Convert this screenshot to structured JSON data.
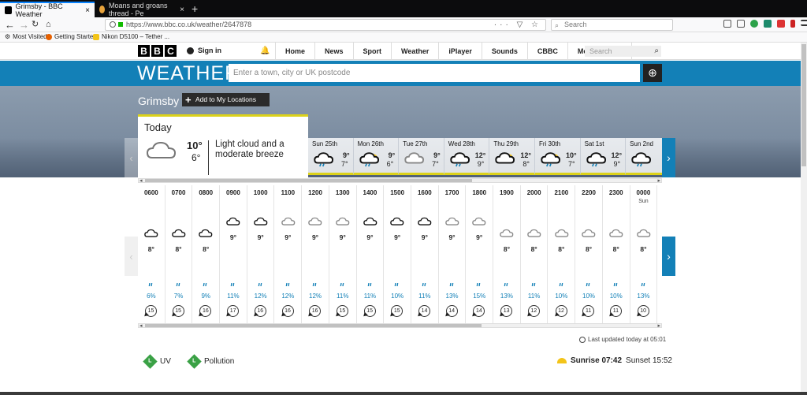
{
  "browser": {
    "tabs": [
      {
        "title": "Grimsby - BBC Weather",
        "close": "×"
      },
      {
        "title": "Moans and groans thread - Pe",
        "close": "×"
      }
    ],
    "new_tab": "+",
    "url": "https://www.bbc.co.uk/weather/2647878",
    "url_icons": "··· ▽ ☆",
    "search_placeholder": "Search",
    "bookmarks": [
      "Most Visited",
      "Getting Started",
      "Nikon D5100 – Tether ..."
    ]
  },
  "bbc": {
    "logo": [
      "B",
      "B",
      "C"
    ],
    "signin": "Sign in",
    "nav": [
      "Home",
      "News",
      "Sport",
      "Weather",
      "iPlayer",
      "Sounds",
      "CBBC",
      "More"
    ],
    "more_caret": "▾",
    "search_placeholder": "Search"
  },
  "weather": {
    "title": "WEATHER",
    "search_placeholder": "Enter a town, city or UK postcode",
    "location": "Grimsby",
    "add_location": "Add to My Locations",
    "today": {
      "label": "Today",
      "high": "10°",
      "low": "6°",
      "description": "Light cloud and a moderate breeze"
    },
    "days": [
      {
        "name": "Sun 25th",
        "high": "9°",
        "low": "7°",
        "icon": "light-rain"
      },
      {
        "name": "Mon 26th",
        "high": "9°",
        "low": "6°",
        "icon": "sunny-intervals-rain"
      },
      {
        "name": "Tue 27th",
        "high": "9°",
        "low": "7°",
        "icon": "light-cloud"
      },
      {
        "name": "Wed 28th",
        "high": "12°",
        "low": "9°",
        "icon": "light-rain"
      },
      {
        "name": "Thu 29th",
        "high": "12°",
        "low": "8°",
        "icon": "sunny-intervals"
      },
      {
        "name": "Fri 30th",
        "high": "10°",
        "low": "7°",
        "icon": "sunny-intervals-rain"
      },
      {
        "name": "Sat 1st",
        "high": "12°",
        "low": "9°",
        "icon": "light-rain"
      },
      {
        "name": "Sun 2nd",
        "high": "1",
        "low": "",
        "icon": "light-rain"
      }
    ],
    "hours": [
      {
        "time": "0600",
        "sub": "",
        "temp": "8°",
        "rain": "6%",
        "wind": "15",
        "icon": "cloud-dark",
        "level": 2
      },
      {
        "time": "0700",
        "sub": "",
        "temp": "8°",
        "rain": "7%",
        "wind": "15",
        "icon": "cloud-dark",
        "level": 2
      },
      {
        "time": "0800",
        "sub": "",
        "temp": "8°",
        "rain": "9%",
        "wind": "16",
        "icon": "cloud-dark",
        "level": 2
      },
      {
        "time": "0900",
        "sub": "",
        "temp": "9°",
        "rain": "11%",
        "wind": "17",
        "icon": "cloud-dark",
        "level": 1
      },
      {
        "time": "1000",
        "sub": "",
        "temp": "9°",
        "rain": "12%",
        "wind": "16",
        "icon": "cloud-dark",
        "level": 1
      },
      {
        "time": "1100",
        "sub": "",
        "temp": "9°",
        "rain": "12%",
        "wind": "16",
        "icon": "cloud-light",
        "level": 1
      },
      {
        "time": "1200",
        "sub": "",
        "temp": "9°",
        "rain": "12%",
        "wind": "16",
        "icon": "cloud-light",
        "level": 1
      },
      {
        "time": "1300",
        "sub": "",
        "temp": "9°",
        "rain": "11%",
        "wind": "15",
        "icon": "cloud-light",
        "level": 1
      },
      {
        "time": "1400",
        "sub": "",
        "temp": "9°",
        "rain": "11%",
        "wind": "15",
        "icon": "cloud-dark",
        "level": 1
      },
      {
        "time": "1500",
        "sub": "",
        "temp": "9°",
        "rain": "10%",
        "wind": "15",
        "icon": "cloud-dark",
        "level": 1
      },
      {
        "time": "1600",
        "sub": "",
        "temp": "9°",
        "rain": "11%",
        "wind": "14",
        "icon": "cloud-dark",
        "level": 1
      },
      {
        "time": "1700",
        "sub": "",
        "temp": "9°",
        "rain": "13%",
        "wind": "14",
        "icon": "cloud-light",
        "level": 1
      },
      {
        "time": "1800",
        "sub": "",
        "temp": "9°",
        "rain": "15%",
        "wind": "14",
        "icon": "cloud-light",
        "level": 1
      },
      {
        "time": "1900",
        "sub": "",
        "temp": "8°",
        "rain": "13%",
        "wind": "13",
        "icon": "cloud-light",
        "level": 2
      },
      {
        "time": "2000",
        "sub": "",
        "temp": "8°",
        "rain": "11%",
        "wind": "12",
        "icon": "cloud-light",
        "level": 2
      },
      {
        "time": "2100",
        "sub": "",
        "temp": "8°",
        "rain": "10%",
        "wind": "12",
        "icon": "cloud-light",
        "level": 2
      },
      {
        "time": "2200",
        "sub": "",
        "temp": "8°",
        "rain": "10%",
        "wind": "11",
        "icon": "cloud-light",
        "level": 2
      },
      {
        "time": "2300",
        "sub": "",
        "temp": "8°",
        "rain": "10%",
        "wind": "11",
        "icon": "cloud-light",
        "level": 2
      },
      {
        "time": "0000",
        "sub": "Sun",
        "temp": "8°",
        "rain": "13%",
        "wind": "10",
        "icon": "cloud-light",
        "level": 2
      }
    ],
    "last_updated": "Last updated today at 05:01",
    "uv": {
      "badge": "L",
      "label": "UV"
    },
    "pollution": {
      "badge": "L",
      "label": "Pollution"
    },
    "sunrise": "Sunrise 07:42",
    "sunset": "Sunset 15:52"
  },
  "colors": {
    "accent": "#1380b7",
    "yellow": "#dcd21a",
    "low_badge": "#3aa145"
  }
}
